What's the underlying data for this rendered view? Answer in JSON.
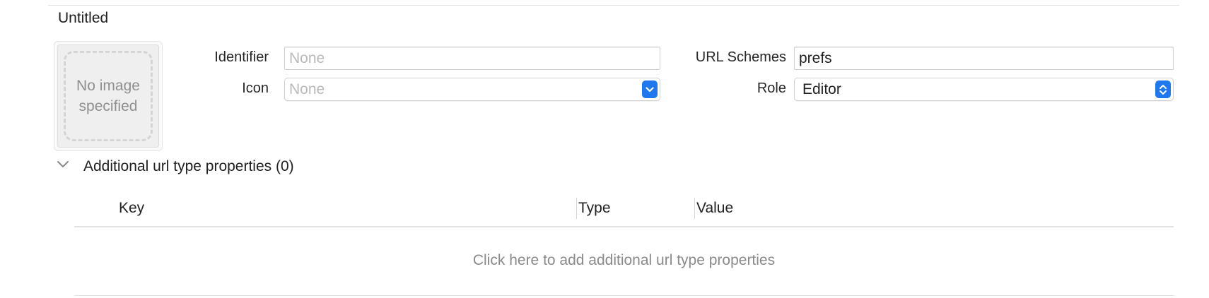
{
  "section": {
    "title": "Untitled"
  },
  "image_well": {
    "placeholder_text": "No image specified"
  },
  "fields": {
    "identifier": {
      "label": "Identifier",
      "value": "",
      "placeholder": "None"
    },
    "icon": {
      "label": "Icon",
      "value": "None",
      "is_placeholder": true,
      "control": "popup",
      "icon": "chevron-down-icon"
    },
    "url_schemes": {
      "label": "URL Schemes",
      "value": "prefs",
      "placeholder": ""
    },
    "role": {
      "label": "Role",
      "value": "Editor",
      "control": "popup",
      "icon": "up-down-chevron-icon"
    }
  },
  "additional_properties": {
    "title": "Additional url type properties (0)",
    "expanded": true,
    "disclosure_icon": "chevron-down-icon",
    "columns": [
      "Key",
      "Type",
      "Value"
    ],
    "rows": [],
    "empty_hint": "Click here to add additional url type properties"
  },
  "colors": {
    "accent": "#1f78f0",
    "placeholder_text": "#b9b9b9",
    "secondary_text": "#8a8a8a"
  }
}
